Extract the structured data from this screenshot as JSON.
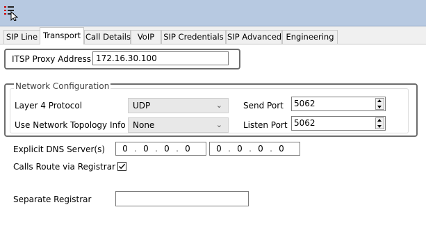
{
  "toolbar": {
    "app_icon": "menu-list-icon"
  },
  "tabs": [
    {
      "label": "SIP Line",
      "active": false
    },
    {
      "label": "Transport",
      "active": true
    },
    {
      "label": "Call Details",
      "active": false
    },
    {
      "label": "VoIP",
      "active": false
    },
    {
      "label": "SIP Credentials",
      "active": false
    },
    {
      "label": "SIP Advanced",
      "active": false
    },
    {
      "label": "Engineering",
      "active": false
    }
  ],
  "itsp": {
    "label": "ITSP Proxy Address",
    "value": "172.16.30.100"
  },
  "network": {
    "title": "Network Configuration",
    "layer4_label": "Layer 4 Protocol",
    "layer4_value": "UDP",
    "topology_label": "Use Network Topology Info",
    "topology_value": "None",
    "send_port_label": "Send Port",
    "send_port_value": "5062",
    "listen_port_label": "Listen Port",
    "listen_port_value": "5062"
  },
  "dns": {
    "label": "Explicit DNS Server(s)",
    "server1": [
      "0",
      "0",
      "0",
      "0"
    ],
    "server2": [
      "0",
      "0",
      "0",
      "0"
    ]
  },
  "registrar": {
    "calls_route_label": "Calls Route via Registrar",
    "calls_route_checked": true,
    "separate_label": "Separate Registrar",
    "separate_value": ""
  },
  "colors": {
    "toolbar": "#b7c9e1",
    "frame": "#6d6d6d",
    "combo_bg": "#e8e8e8"
  }
}
